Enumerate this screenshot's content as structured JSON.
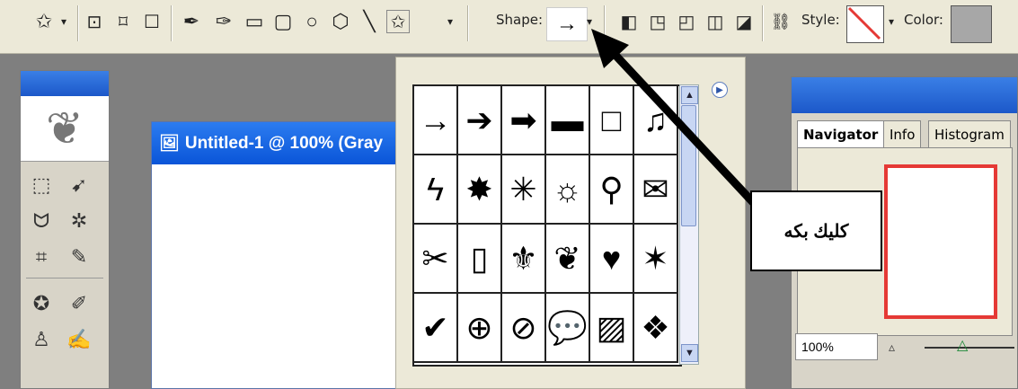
{
  "options_bar": {
    "shape_label": "Shape:",
    "shape_value": "→",
    "style_label": "Style:",
    "color_label": "Color:",
    "color_value": "#a7a7a7"
  },
  "document": {
    "title": "Untitled-1 @ 100% (Gray"
  },
  "shape_picker": {
    "cells": [
      "→",
      "➔",
      "➡",
      "▬",
      "□",
      "♫",
      "ϟ",
      "✸",
      "✳",
      "☼",
      "⚲",
      "✉",
      "✂",
      "▯",
      "⚜",
      "❦",
      "♥",
      "✶",
      "✔",
      "⊕",
      "⊘",
      "💬",
      "▨",
      "❖"
    ]
  },
  "navigator": {
    "tabs": [
      "Navigator",
      "Info",
      "Histogram"
    ],
    "zoom": "100%",
    "frame_color": "#e53935"
  },
  "callout": {
    "text": "كليك بكه"
  }
}
